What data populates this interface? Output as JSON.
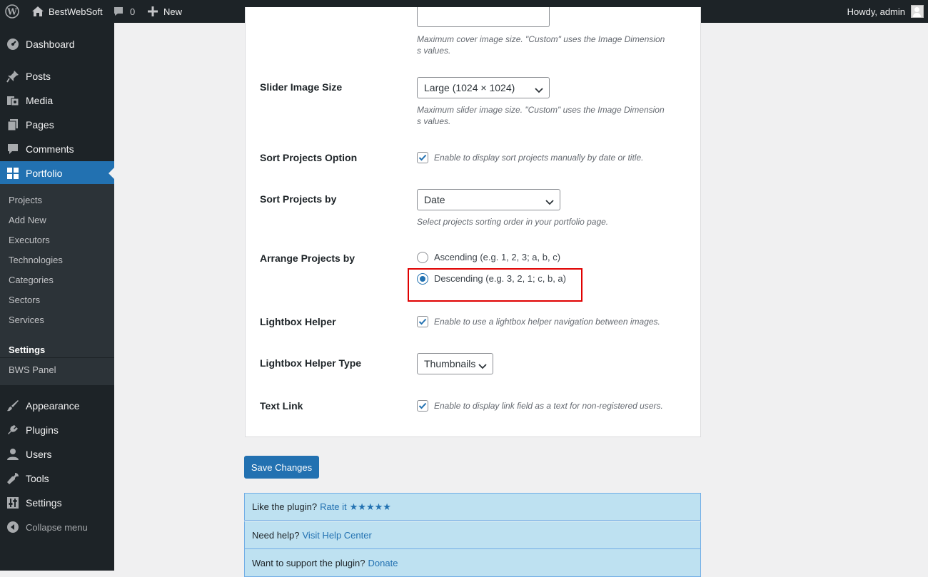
{
  "adminbar": {
    "site_name": "BestWebSoft",
    "comments_count": "0",
    "new_label": "New",
    "howdy": "Howdy, admin"
  },
  "sidebar": {
    "dashboard": "Dashboard",
    "posts": "Posts",
    "media": "Media",
    "pages": "Pages",
    "comments": "Comments",
    "portfolio": "Portfolio",
    "submenu": [
      "Projects",
      "Add New",
      "Executors",
      "Technologies",
      "Categories",
      "Sectors",
      "Services",
      "Settings",
      "BWS Panel"
    ],
    "appearance": "Appearance",
    "plugins": "Plugins",
    "users": "Users",
    "tools": "Tools",
    "settings": "Settings",
    "collapse": "Collapse menu"
  },
  "settings": {
    "cover_desc": "Maximum cover image size. \"Custom\" uses the Image Dimension",
    "cover_desc2": "s values.",
    "slider_label": "Slider Image Size",
    "slider_value": "Large (1024 × 1024)",
    "slider_desc": "Maximum slider image size. \"Custom\" uses the Image Dimension",
    "slider_desc2": "s values.",
    "sort_option_label": "Sort Projects Option",
    "sort_option_text": "Enable to display sort projects manually by date or title.",
    "sort_option_checked": true,
    "sort_by_label": "Sort Projects by",
    "sort_by_value": "Date",
    "sort_by_desc": "Select projects sorting order in your portfolio page.",
    "arrange_label": "Arrange Projects by",
    "arrange_options": [
      "Ascending (e.g. 1, 2, 3; a, b, c)",
      "Descending (e.g. 3, 2, 1; c, b, a)"
    ],
    "arrange_selected": "Descending (e.g. 3, 2, 1; c, b, a)",
    "lightbox_label": "Lightbox Helper",
    "lightbox_text": "Enable to use a lightbox helper navigation between images.",
    "lightbox_checked": true,
    "lightbox_type_label": "Lightbox Helper Type",
    "lightbox_type_value": "Thumbnails",
    "text_link_label": "Text Link",
    "text_link_text": "Enable to display link field as a text for non-registered users.",
    "text_link_checked": true
  },
  "save_button": "Save Changes",
  "info": {
    "like_text": "Like the plugin?",
    "rate_link": "Rate it",
    "stars": "★★★★★",
    "help_text": "Need help?",
    "help_link": "Visit Help Center",
    "support_text": "Want to support the plugin?",
    "donate_link": "Donate"
  },
  "colors": {
    "accent": "#2271b1",
    "sidebar_bg": "#1d2327",
    "highlight": "#e00000",
    "info_bg": "#bee1f1"
  }
}
